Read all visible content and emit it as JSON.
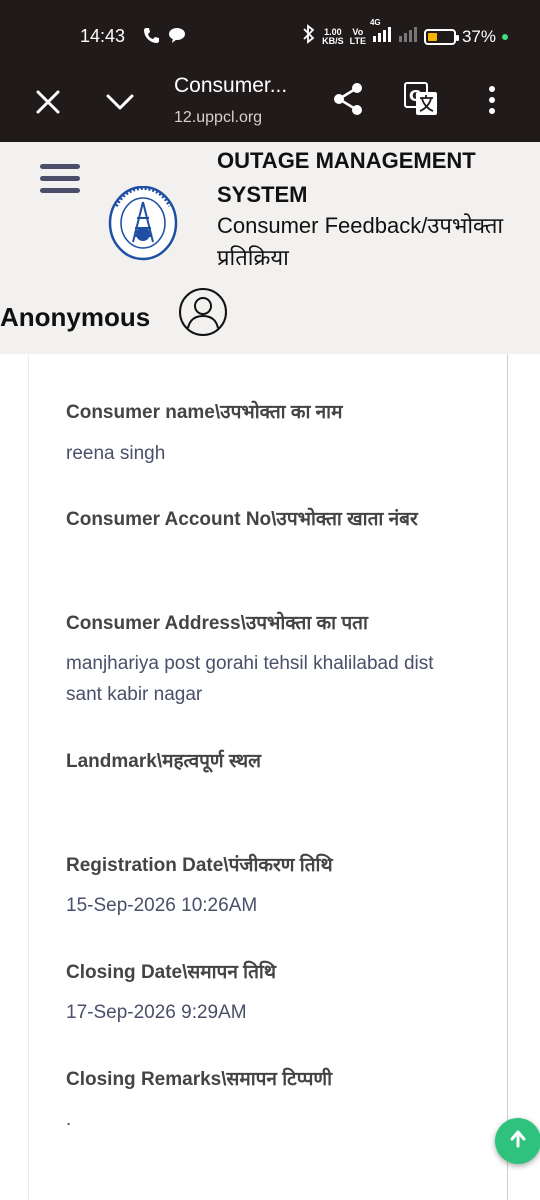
{
  "status_bar": {
    "time": "14:43",
    "net_speed_top": "1.00",
    "net_speed_bottom": "KB/S",
    "volte_top": "Vo",
    "volte_bottom": "LTE",
    "network": "4G",
    "battery_percent": "37%",
    "battery_level": 0.37,
    "battery_color": "#f5b400"
  },
  "browser": {
    "title": "Consumer...",
    "url": "12.uppcl.org",
    "icons": [
      "close-icon",
      "chevron-down-icon",
      "share-icon",
      "translate-icon",
      "more-vert-icon"
    ]
  },
  "header": {
    "title": "OUTAGE MANAGEMENT SYSTEM",
    "subtitle": "Consumer Feedback/उपभोक्ता प्रतिक्रिया",
    "user": "Anonymous",
    "accent_color": "#1f4fa3"
  },
  "fields": [
    {
      "label": "Consumer name\\उपभोक्ता का नाम",
      "value": "reena singh"
    },
    {
      "label": "Consumer Account No\\उपभोक्ता खाता नंबर",
      "value": ""
    },
    {
      "label": "Consumer Address\\उपभोक्ता का पता",
      "value": "manjhariya post gorahi tehsil khalilabad dist sant kabir nagar"
    },
    {
      "label": "Landmark\\महत्वपूर्ण स्थल",
      "value": ""
    },
    {
      "label": "Registration Date\\पंजीकरण तिथि",
      "value": "15-Sep-2026 10:26AM"
    },
    {
      "label": "Closing Date\\समापन तिथि",
      "value": "17-Sep-2026 9:29AM"
    },
    {
      "label": "Closing Remarks\\समापन टिप्पणी",
      "value": "."
    }
  ],
  "fab": {
    "icon": "arrow-up-icon",
    "color": "#2ec27e"
  }
}
